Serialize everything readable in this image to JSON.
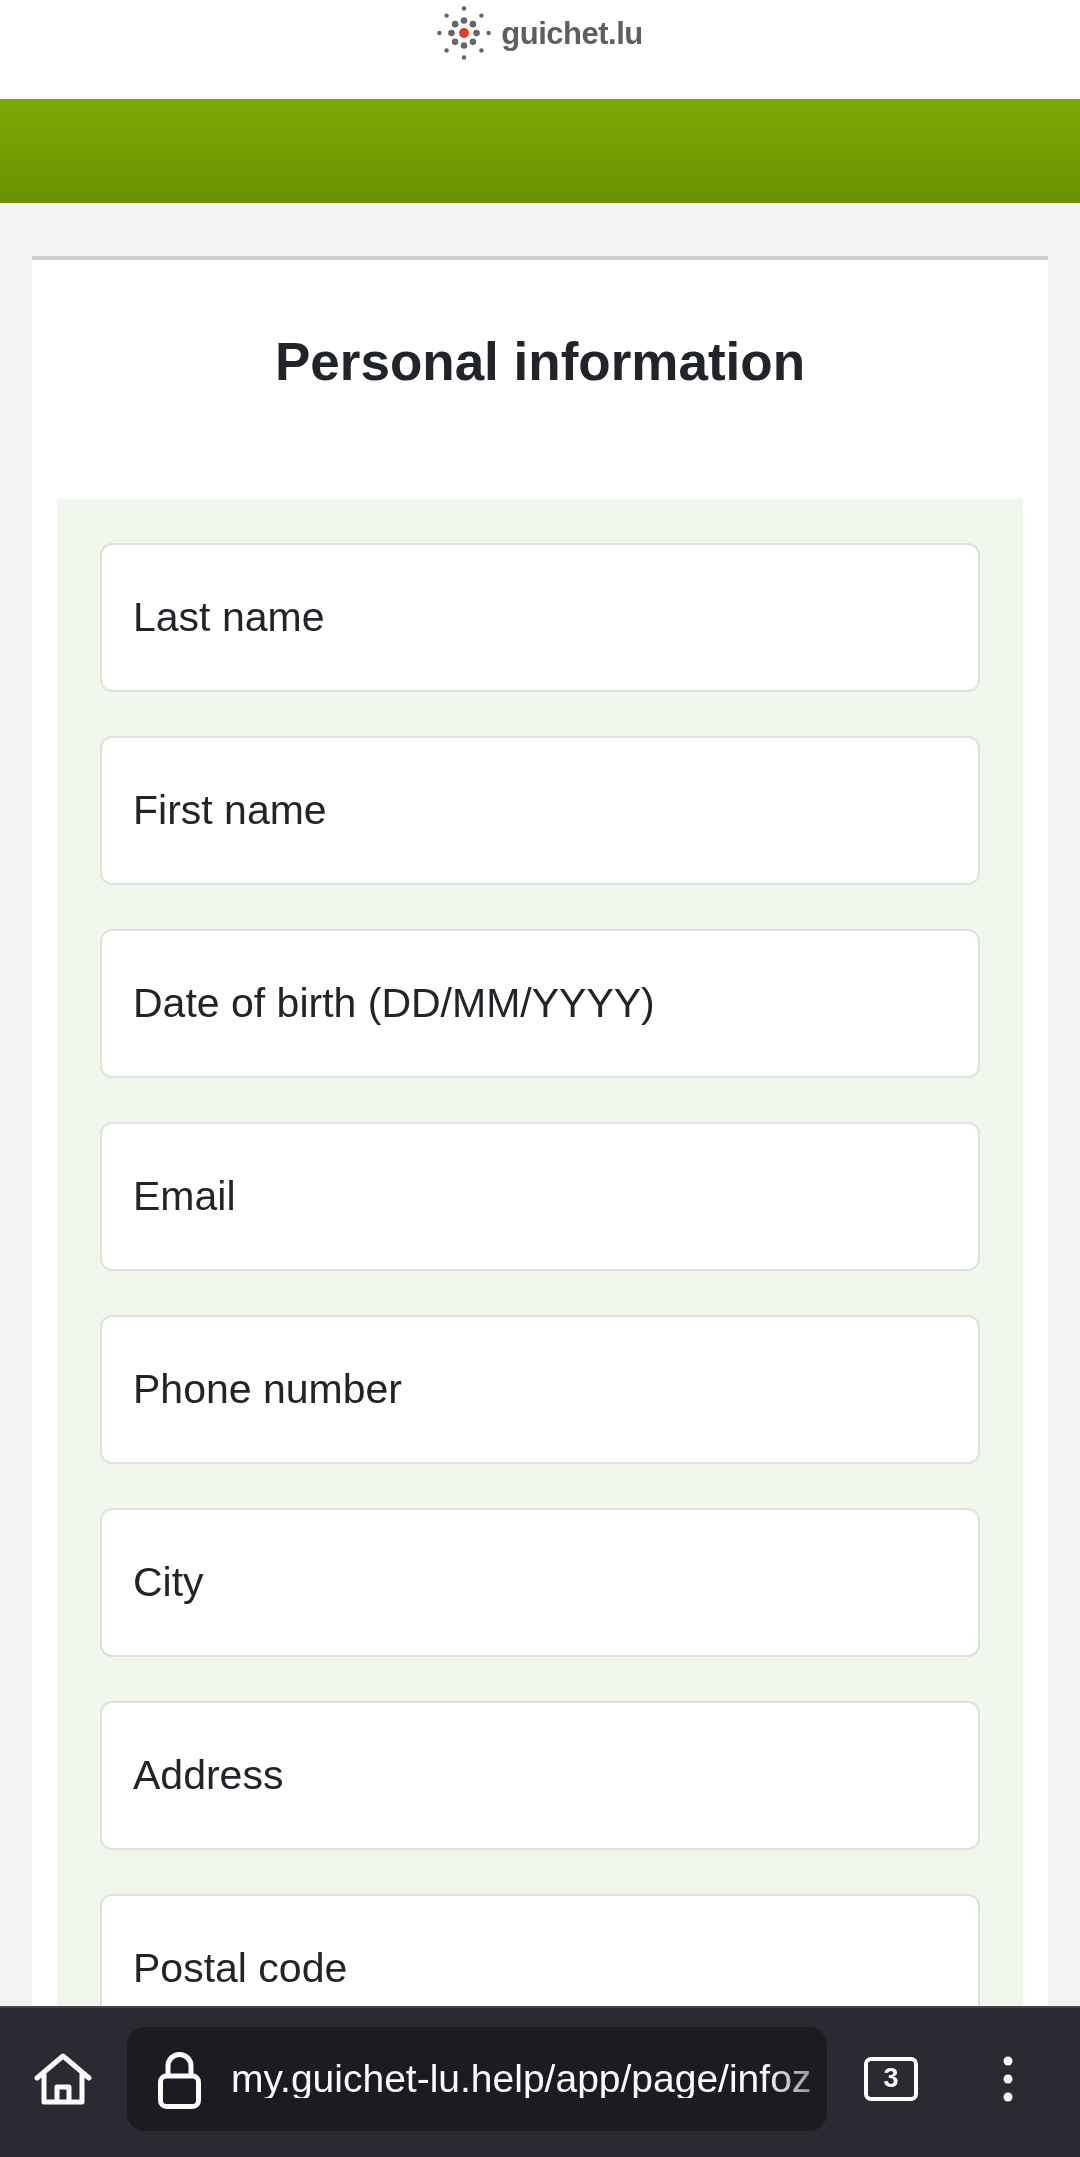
{
  "header": {
    "logo_text": "guichet.lu"
  },
  "form": {
    "title": "Personal information",
    "fields": [
      {
        "placeholder": "Last name"
      },
      {
        "placeholder": "First name"
      },
      {
        "placeholder": "Date of birth (DD/MM/YYYY)"
      },
      {
        "placeholder": "Email"
      },
      {
        "placeholder": "Phone number"
      },
      {
        "placeholder": "City"
      },
      {
        "placeholder": "Address"
      },
      {
        "placeholder": "Postal code"
      }
    ]
  },
  "browser_bar": {
    "url": "my.guichet-lu.help/app/page/infoz",
    "tab_count": "3"
  }
}
